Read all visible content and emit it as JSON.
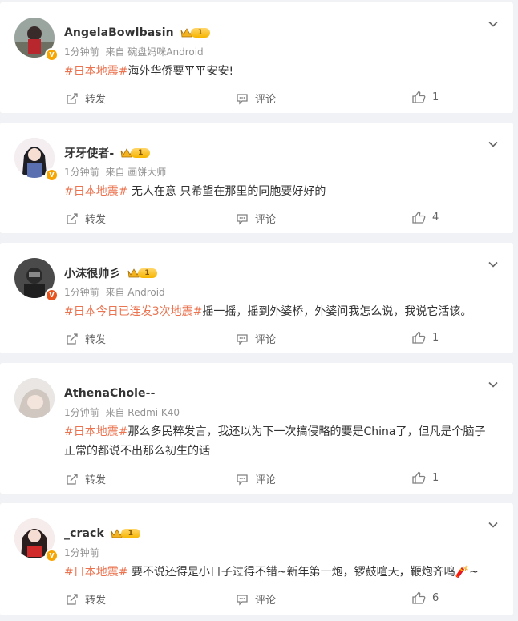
{
  "labels": {
    "repost": "转发",
    "comment": "评论"
  },
  "colors": {
    "tag": "#eb7350",
    "verified": "#f7a500",
    "meta": "#939393"
  },
  "posts": [
    {
      "name": "AngelaBowlbasin",
      "level": "1",
      "time": "1分钟前",
      "source": "来自 碗盘妈咪Android",
      "tag": "#日本地震#",
      "text": "海外华侨要平平安安!",
      "likes": "1"
    },
    {
      "name": "牙牙使者-",
      "level": "1",
      "time": "1分钟前",
      "source": "来自 画饼大师",
      "tag": "#日本地震#",
      "text": " 无人在意 只希望在那里的同胞要好好的",
      "likes": "4"
    },
    {
      "name": "小沫很帅彡",
      "level": "1",
      "time": "1分钟前",
      "source": "来自 Android",
      "tag": "#日本今日已连发3次地震#",
      "text": "摇一摇，摇到外婆桥，外婆问我怎么说，我说它活该。",
      "likes": "1"
    },
    {
      "name": "AthenaChole--",
      "level": "",
      "time": "1分钟前",
      "source": "来自 Redmi K40",
      "tag": "#日本地震#",
      "text": "那么多民粹发言，我还以为下一次搞侵略的要是China了，但凡是个脑子正常的都说不出那么初生的话",
      "likes": "1"
    },
    {
      "name": "_crack",
      "level": "1",
      "time": "1分钟前",
      "source": "",
      "tag": "#日本地震#",
      "text": " 要不说还得是小日子过得不错~新年第一炮，锣鼓喧天，鞭炮齐鸣🧨~",
      "likes": "6"
    }
  ]
}
